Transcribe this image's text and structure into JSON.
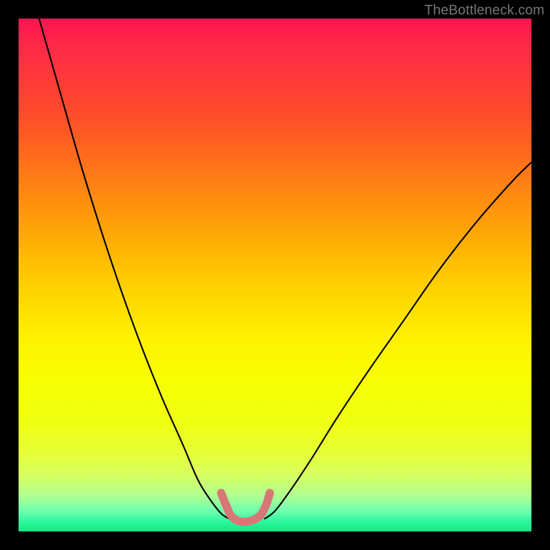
{
  "watermark": "TheBottleneck.com",
  "chart_data": {
    "type": "line",
    "title": "",
    "xlabel": "",
    "ylabel": "",
    "xlim": [
      0,
      100
    ],
    "ylim": [
      0,
      100
    ],
    "series": [
      {
        "name": "left-curve",
        "x": [
          4,
          8,
          12,
          16,
          20,
          24,
          28,
          32,
          35,
          37.5,
          39.5,
          41
        ],
        "y": [
          100,
          86,
          72,
          59,
          47,
          36,
          26,
          17,
          10,
          6,
          3.5,
          2.5
        ]
      },
      {
        "name": "right-curve",
        "x": [
          48,
          50,
          53,
          57,
          62,
          68,
          75,
          82,
          89,
          96,
          100
        ],
        "y": [
          2.5,
          4,
          8,
          14,
          22,
          31,
          41,
          51,
          60,
          68,
          72
        ]
      },
      {
        "name": "trough-marker",
        "x": [
          39.5,
          40.5,
          41.5,
          43,
          45,
          47,
          48.2,
          49
        ],
        "y": [
          7.5,
          5,
          3,
          2,
          2,
          3,
          5,
          7.5
        ]
      }
    ],
    "colors": {
      "curve": "#000000",
      "marker": "#d97777",
      "gradient_top": "#ff1450",
      "gradient_mid": "#fff000",
      "gradient_bottom": "#10e880"
    }
  }
}
